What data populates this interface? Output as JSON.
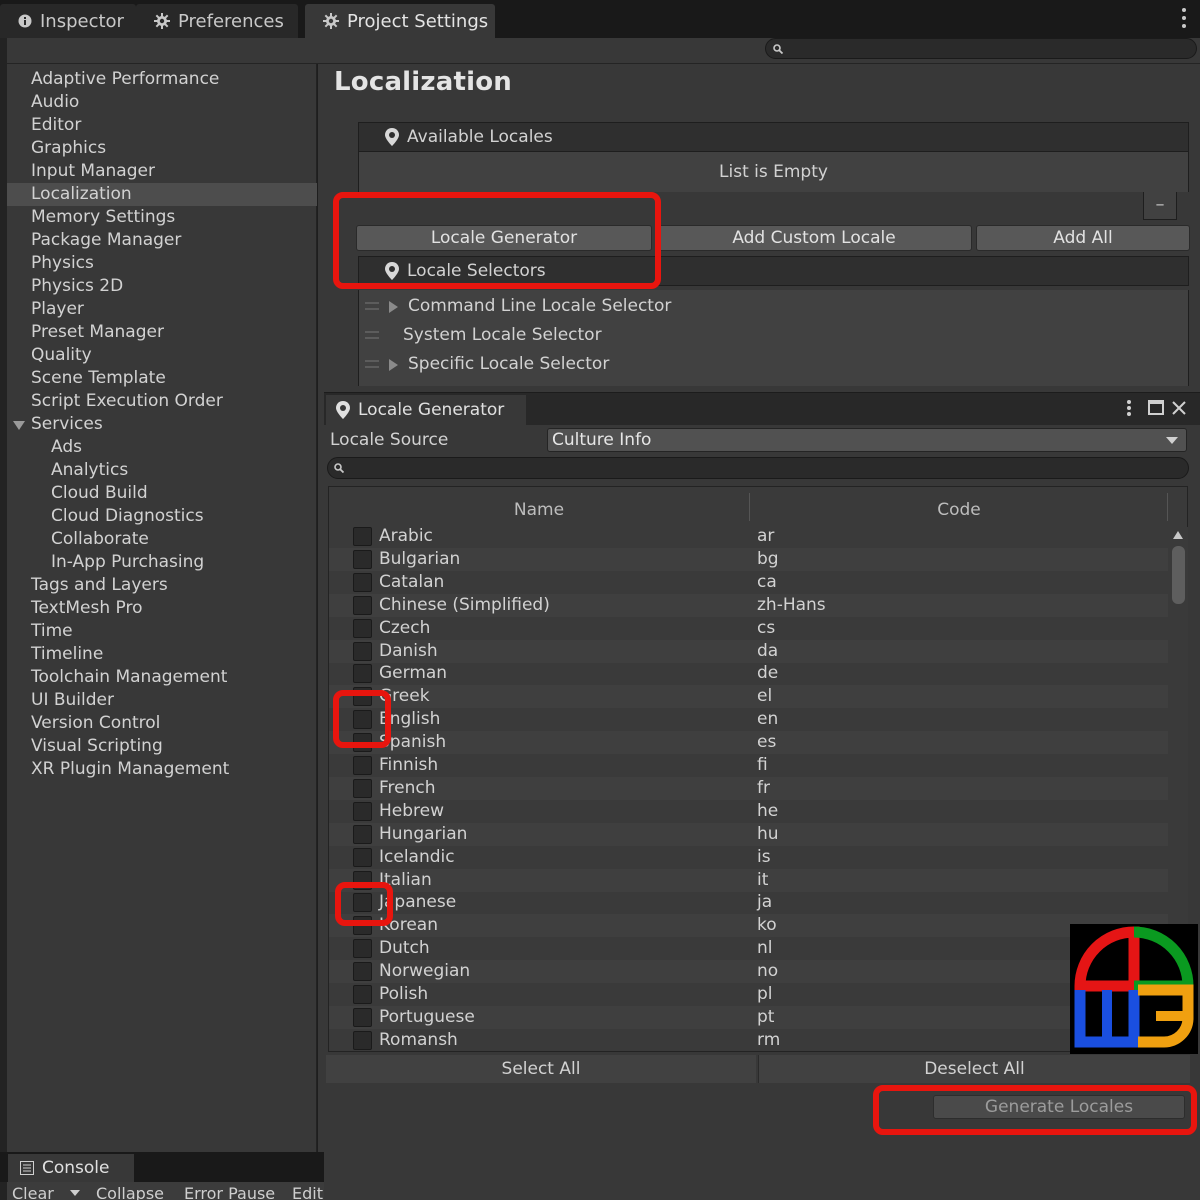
{
  "tabs": [
    {
      "label": "Inspector",
      "icon": "info-icon"
    },
    {
      "label": "Preferences",
      "icon": "gear-icon"
    },
    {
      "label": "Project Settings",
      "icon": "gear-icon",
      "active": true
    }
  ],
  "sidebar": {
    "items": [
      {
        "label": "Adaptive Performance"
      },
      {
        "label": "Audio"
      },
      {
        "label": "Editor"
      },
      {
        "label": "Graphics"
      },
      {
        "label": "Input Manager"
      },
      {
        "label": "Localization",
        "selected": true
      },
      {
        "label": "Memory Settings"
      },
      {
        "label": "Package Manager"
      },
      {
        "label": "Physics"
      },
      {
        "label": "Physics 2D"
      },
      {
        "label": "Player"
      },
      {
        "label": "Preset Manager"
      },
      {
        "label": "Quality"
      },
      {
        "label": "Scene Template"
      },
      {
        "label": "Script Execution Order"
      },
      {
        "label": "Services",
        "expanded": true
      },
      {
        "label": "Ads",
        "sub": true
      },
      {
        "label": "Analytics",
        "sub": true
      },
      {
        "label": "Cloud Build",
        "sub": true
      },
      {
        "label": "Cloud Diagnostics",
        "sub": true
      },
      {
        "label": "Collaborate",
        "sub": true
      },
      {
        "label": "In-App Purchasing",
        "sub": true
      },
      {
        "label": "Tags and Layers"
      },
      {
        "label": "TextMesh Pro"
      },
      {
        "label": "Time"
      },
      {
        "label": "Timeline"
      },
      {
        "label": "Toolchain Management"
      },
      {
        "label": "UI Builder"
      },
      {
        "label": "Version Control"
      },
      {
        "label": "Visual Scripting"
      },
      {
        "label": "XR Plugin Management"
      }
    ]
  },
  "main": {
    "title": "Localization",
    "available_locales": {
      "header": "Available Locales",
      "empty_text": "List is Empty",
      "remove_label": "–"
    },
    "buttons": {
      "locale_generator": "Locale Generator",
      "add_custom_locale": "Add Custom Locale",
      "add_all": "Add All"
    },
    "locale_selectors": {
      "header": "Locale Selectors",
      "items": [
        {
          "label": "Command Line Locale Selector",
          "expandable": true
        },
        {
          "label": "System Locale Selector",
          "expandable": false
        },
        {
          "label": "Specific Locale Selector",
          "expandable": true
        }
      ]
    }
  },
  "locale_generator": {
    "title": "Locale Generator",
    "source_label": "Locale Source",
    "source_value": "Culture Info",
    "columns": {
      "name": "Name",
      "code": "Code"
    },
    "locales": [
      {
        "name": "Arabic",
        "code": "ar",
        "checked": false
      },
      {
        "name": "Bulgarian",
        "code": "bg",
        "checked": false
      },
      {
        "name": "Catalan",
        "code": "ca",
        "checked": false
      },
      {
        "name": "Chinese (Simplified)",
        "code": "zh-Hans",
        "checked": false
      },
      {
        "name": "Czech",
        "code": "cs",
        "checked": false
      },
      {
        "name": "Danish",
        "code": "da",
        "checked": false
      },
      {
        "name": "German",
        "code": "de",
        "checked": false
      },
      {
        "name": "Greek",
        "code": "el",
        "checked": false
      },
      {
        "name": "English",
        "code": "en",
        "checked": false
      },
      {
        "name": "Spanish",
        "code": "es",
        "checked": false
      },
      {
        "name": "Finnish",
        "code": "fi",
        "checked": false
      },
      {
        "name": "French",
        "code": "fr",
        "checked": false
      },
      {
        "name": "Hebrew",
        "code": "he",
        "checked": false
      },
      {
        "name": "Hungarian",
        "code": "hu",
        "checked": false
      },
      {
        "name": "Icelandic",
        "code": "is",
        "checked": false
      },
      {
        "name": "Italian",
        "code": "it",
        "checked": false
      },
      {
        "name": "Japanese",
        "code": "ja",
        "checked": false
      },
      {
        "name": "Korean",
        "code": "ko",
        "checked": false
      },
      {
        "name": "Dutch",
        "code": "nl",
        "checked": false
      },
      {
        "name": "Norwegian",
        "code": "no",
        "checked": false
      },
      {
        "name": "Polish",
        "code": "pl",
        "checked": false
      },
      {
        "name": "Portuguese",
        "code": "pt",
        "checked": false
      },
      {
        "name": "Romansh",
        "code": "rm",
        "checked": false
      }
    ],
    "select_all": "Select All",
    "deselect_all": "Deselect All",
    "generate": "Generate Locales"
  },
  "console": {
    "tab_label": "Console",
    "buttons": [
      "Clear",
      "Collapse",
      "Error Pause",
      "Edit"
    ]
  },
  "colors": {
    "panel_bg": "#383838",
    "highlight_red": "#e8150e",
    "selected_row": "#4d4d4d"
  }
}
